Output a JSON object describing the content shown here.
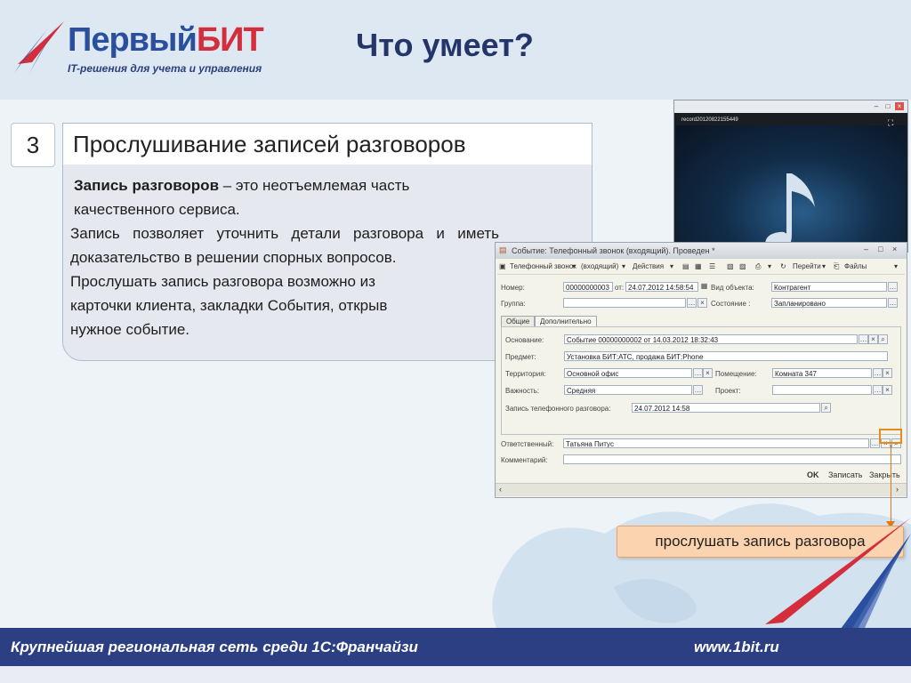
{
  "brand": {
    "name_part1": "Первый",
    "name_part2": "БИТ",
    "tagline": "IT-решения для учета и управления"
  },
  "page_title": "Что умеет?",
  "step": {
    "number": "3",
    "title": "Прослушивание записей разговоров",
    "bold_lead": "Запись разговоров",
    "lead_rest": " – это неотъемлемая часть",
    "line2": "качественного сервиса.",
    "para1_line1": "Запись позволяет уточнить детали разговора и  иметь",
    "para1_line2": "доказательство в решении спорных вопросов.",
    "para2_line1": "Прослушать запись разговора возможно из",
    "para2_line2": "карточки клиента, закладки События, открыв",
    "para2_line3": "нужное событие."
  },
  "player": {
    "filename": "record20120822155449"
  },
  "window": {
    "title": "Событие: Телефонный звонок (входящий). Проведен *",
    "toolbar": {
      "doc_type": "Телефонный звонок",
      "direction": "(входящий)",
      "actions": "Действия",
      "goto": "Перейти",
      "files": "Файлы"
    },
    "fields": {
      "number_label": "Номер:",
      "number_value": "00000000003",
      "from_label": "от:",
      "date_value": "24.07.2012 14:58:54",
      "object_type_label": "Вид объекта:",
      "object_type_value": "Контрагент",
      "group_label": "Группа:",
      "group_value": "",
      "state_label": "Состояние :",
      "state_value": "Запланировано"
    },
    "tabs": [
      "Общие",
      "Дополнительно"
    ],
    "panel": {
      "basis_label": "Основание:",
      "basis_value": "Событие 00000000002 от 14.03.2012 18:32:43",
      "subject_label": "Предмет:",
      "subject_value": "Установка БИТ:АТС, продажа БИТ:Phone",
      "territory_label": "Территория:",
      "territory_value": "Основной офис",
      "room_label": "Помещение:",
      "room_value": "Комната 347",
      "importance_label": "Важность:",
      "importance_value": "Средняя",
      "project_label": "Проект:",
      "project_value": "",
      "recording_label": "Запись телефонного разговора:",
      "recording_value": "24.07.2012 14:58"
    },
    "responsible_label": "Ответственный:",
    "responsible_value": "Татьяна Питус",
    "comment_label": "Комментарий:",
    "comment_value": "",
    "buttons": {
      "ok": "OK",
      "save": "Записать",
      "close": "Закрыть"
    }
  },
  "callout": "прослушать запись разговора",
  "footer": {
    "left": "Крупнейшая региональная сеть среди 1С:Франчайзи",
    "right": "www.1bit.ru"
  },
  "colors": {
    "brand_blue": "#2a4f9e",
    "brand_red": "#d42d3b",
    "footer_bg": "#2d3f83",
    "callout_bg": "#fbd3ae",
    "highlight": "#e88a1a"
  }
}
